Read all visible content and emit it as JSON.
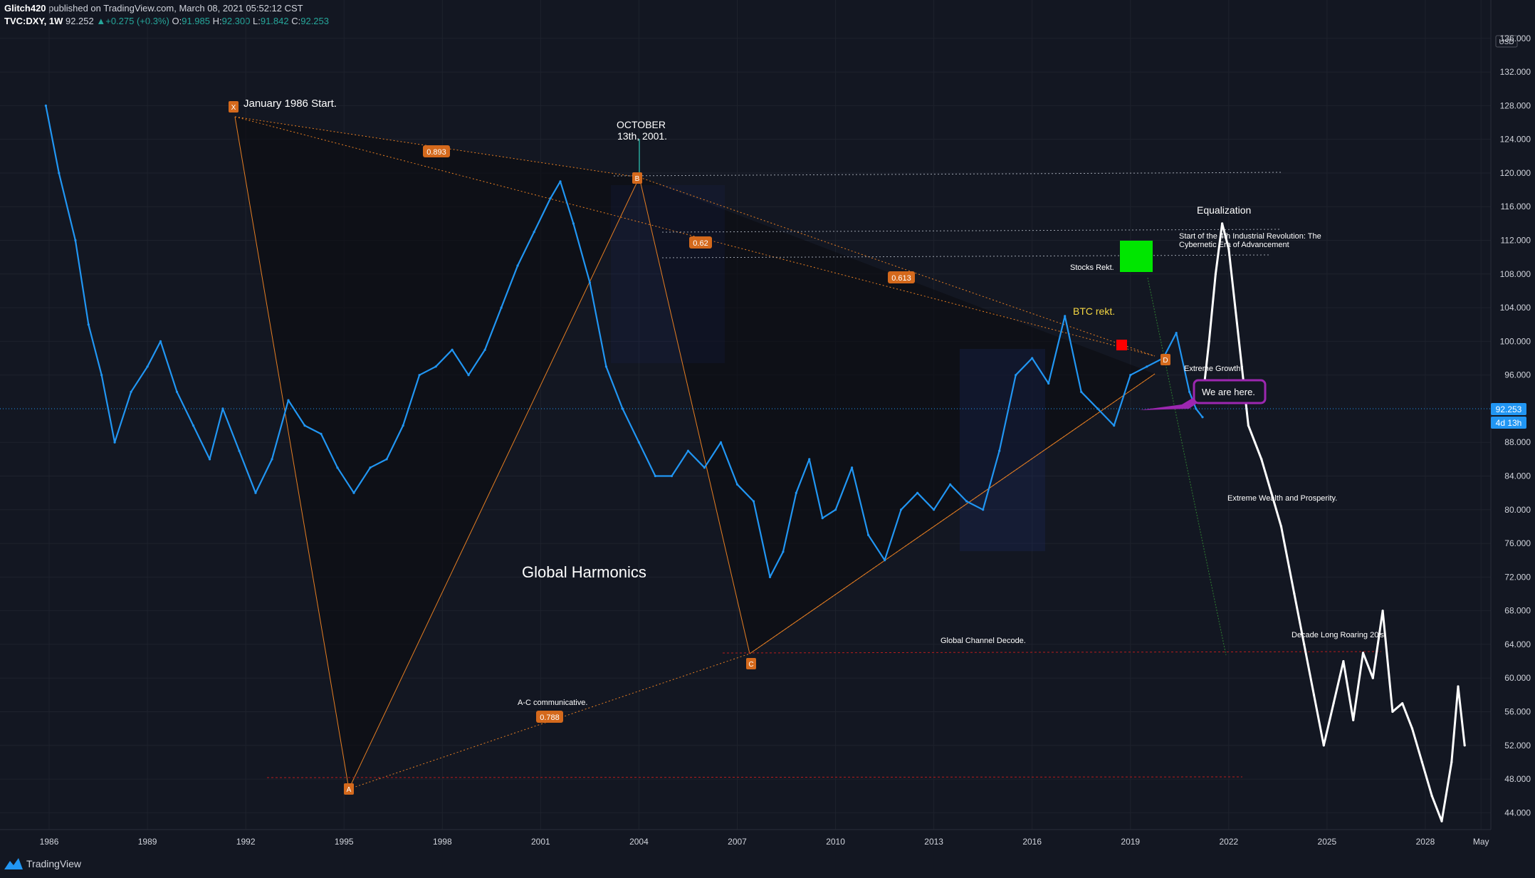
{
  "header": {
    "author": "Glitch420",
    "published_text": " published on TradingView.com, March 08, 2021 05:52:12 CST",
    "symbol": "TVC:DXY, 1W",
    "last": "92.252",
    "change_arrow": "▲",
    "change": "+0.275 (+0.3%)",
    "open_label": "O:",
    "open": "91.985",
    "high_label": "H:",
    "high": "92.300",
    "low_label": "L:",
    "low": "91.842",
    "close_label": "C:",
    "close": "92.253"
  },
  "footer": {
    "brand": "TradingView"
  },
  "price_axis": {
    "currency": "USD",
    "ticks": [
      "44.000",
      "48.000",
      "52.000",
      "56.000",
      "60.000",
      "64.000",
      "68.000",
      "72.000",
      "76.000",
      "80.000",
      "84.000",
      "88.000",
      "96.000",
      "100.000",
      "104.000",
      "108.000",
      "112.000",
      "116.000",
      "120.000",
      "124.000",
      "128.000",
      "132.000",
      "136.000"
    ],
    "last_price_badge": "92.253",
    "countdown_badge": "4d 13h"
  },
  "colors": {
    "background": "#131722",
    "price_line": "#2196f3",
    "projection": "#ffffff",
    "pattern_line": "#e67e22",
    "badge": "#d4691c",
    "red_line": "#b71c1c",
    "purple_box": "#9c27b0",
    "green_box": "#00e600",
    "red_box": "#ff0000"
  },
  "chart_data": {
    "type": "line",
    "title": "",
    "xlabel": "",
    "ylabel": "USD",
    "x_ticks": [
      "1986",
      "1989",
      "1992",
      "1995",
      "1998",
      "2001",
      "2004",
      "2007",
      "2010",
      "2013",
      "2016",
      "2019",
      "2022",
      "2025",
      "2028",
      "May"
    ],
    "ylim": [
      42,
      137
    ],
    "xlim": [
      1984.5,
      2030.0
    ],
    "series": [
      {
        "x": [
          1985.9,
          1986.3,
          1986.8,
          1987.2,
          1987.6,
          1988.0,
          1988.5,
          1989.0,
          1989.4,
          1989.9,
          1990.4,
          1990.9,
          1991.3,
          1991.8,
          1992.3,
          1992.8,
          1993.3,
          1993.8,
          1994.3,
          1994.8,
          1995.3,
          1995.8,
          1996.3,
          1996.8,
          1997.3,
          1997.8,
          1998.3,
          1998.8,
          1999.3,
          1999.8,
          2000.3,
          2000.8,
          2001.3,
          2001.6,
          2002.0,
          2002.5,
          2003.0,
          2003.5,
          2004.0,
          2004.5,
          2005.0,
          2005.5,
          2006.0,
          2006.5,
          2007.0,
          2007.5,
          2008.0,
          2008.4,
          2008.8,
          2009.2,
          2009.6,
          2010.0,
          2010.5,
          2011.0,
          2011.5,
          2012.0,
          2012.5,
          2013.0,
          2013.5,
          2014.0,
          2014.5,
          2015.0,
          2015.5,
          2016.0,
          2016.5,
          2017.0,
          2017.5,
          2018.0,
          2018.5,
          2019.0,
          2019.5,
          2020.0,
          2020.4,
          2020.8,
          2021.0,
          2021.2
        ],
        "values": [
          128.0,
          120.0,
          112.0,
          102.0,
          96.0,
          88.0,
          94.0,
          97.0,
          100.0,
          94.0,
          90.0,
          86.0,
          92.0,
          87.0,
          82.0,
          86.0,
          93.0,
          90.0,
          89.0,
          85.0,
          82.0,
          85.0,
          86.0,
          90.0,
          96.0,
          97.0,
          99.0,
          96.0,
          99.0,
          104.0,
          109.0,
          113.0,
          117.0,
          119.0,
          114.0,
          107.0,
          97.0,
          92.0,
          88.0,
          84.0,
          84.0,
          87.0,
          85.0,
          88.0,
          83.0,
          81.0,
          72.0,
          75.0,
          82.0,
          86.0,
          79.0,
          80.0,
          85.0,
          77.0,
          74.0,
          80.0,
          82.0,
          80.0,
          83.0,
          81.0,
          80.0,
          87.0,
          96.0,
          98.0,
          95.0,
          103.0,
          94.0,
          92.0,
          90.0,
          96.0,
          97.0,
          98.0,
          101.0,
          94.0,
          92.0,
          91.0
        ]
      },
      {
        "x": [
          2021.2,
          2021.4,
          2021.6,
          2021.8,
          2022.0,
          2022.2,
          2022.4,
          2022.6,
          2022.8,
          2023.0,
          2023.3,
          2023.6,
          2024.0,
          2024.3,
          2024.6,
          2024.9,
          2025.2,
          2025.5,
          2025.8,
          2026.1,
          2026.4,
          2026.7,
          2027.0,
          2027.3,
          2027.6,
          2027.9,
          2028.2,
          2028.5,
          2028.8,
          2029.0,
          2029.2
        ],
        "values": [
          93.0,
          100.0,
          108.0,
          114.0,
          111.0,
          104.0,
          97.0,
          90.0,
          88.0,
          86.0,
          82.0,
          78.0,
          70.0,
          64.0,
          58.0,
          52.0,
          57.0,
          62.0,
          55.0,
          63.0,
          60.0,
          68.0,
          56.0,
          57.0,
          54.0,
          50.0,
          46.0,
          43.0,
          50.0,
          59.0,
          52.0
        ]
      }
    ],
    "pattern": {
      "points": [
        {
          "label": "X",
          "x": 1985.9,
          "y": 128.0
        },
        {
          "label": "A",
          "x": 1990.4,
          "y": 46.5
        },
        {
          "label": "B",
          "x": 2001.7,
          "y": 120.3
        },
        {
          "label": "C",
          "x": 2006.3,
          "y": 62.0
        },
        {
          "label": "D",
          "x": 2022.5,
          "y": 98.0
        }
      ],
      "ratios": [
        "0.893",
        "0.62",
        "0.613",
        "0.788"
      ]
    },
    "annotations": [
      "January 1986 Start.",
      "OCTOBER",
      "13th, 2001.",
      "Equalization",
      "Start of the 4th Industrial Revolution: The",
      "Cybernetic Era of Advancement",
      "Stocks Rekt.",
      "BTC rekt.",
      "Extreme Growth.",
      "We are here.",
      "Extreme Wealth and Prosperity.",
      "Global Harmonics",
      "Global Channel Decode.",
      "Decade Long Roaring 20's.",
      "A-C communicative."
    ]
  }
}
